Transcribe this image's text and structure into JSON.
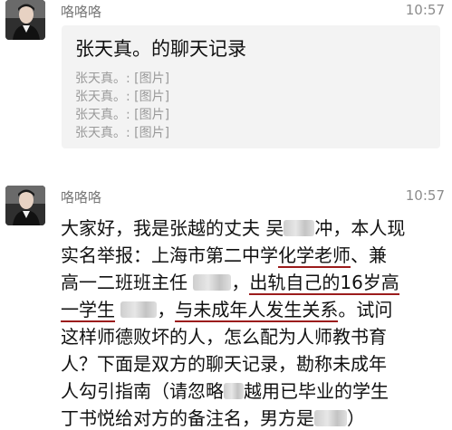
{
  "messages": [
    {
      "sender": "咯咯咯",
      "time": "10:57",
      "card": {
        "title": "张天真。的聊天记录",
        "lines": [
          "张天真。: [图片]",
          "张天真。: [图片]",
          "张天真。: [图片]",
          "张天真。: [图片]"
        ]
      }
    },
    {
      "sender": "咯咯咯",
      "time": "10:57",
      "text": {
        "l1_a": "大家好，我是张越的丈夫 吴",
        "l1_b": "冲，本人现",
        "l2_a": "实名举报：上海市第二中学",
        "l2_u": "化学老师",
        "l2_b": "、兼",
        "l3_a": "高一二班班主任 ",
        "l3_b": "，",
        "l3_u": "出轨自己的16岁高",
        "l4_u1": "一学生",
        "l4_a": " ",
        "l4_b": "，",
        "l4_u2": "与未成年人发生关系",
        "l4_c": "。试问",
        "l5": "这样师德败坏的人，怎么配为人师教书育",
        "l6": "人？下面是双方的聊天记录，勘称未成年",
        "l7_a": "人勾引指南（请忽略",
        "l7_b": "越用已毕业的学生",
        "l8_a": "丁书悦给对方的备注名，男方是",
        "l8_b": "）"
      }
    }
  ]
}
